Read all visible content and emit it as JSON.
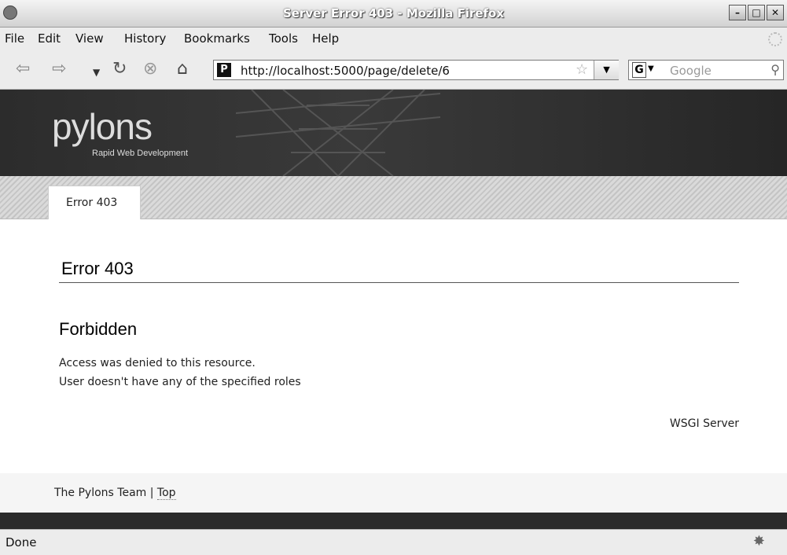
{
  "window": {
    "title": "Server Error 403 - Mozilla Firefox"
  },
  "menu": [
    "File",
    "Edit",
    "View",
    "History",
    "Bookmarks",
    "Tools",
    "Help"
  ],
  "nav": {
    "url": "http://localhost:5000/page/delete/6",
    "search_placeholder": "Google",
    "search_engine": "G"
  },
  "site": {
    "logo": "pylons",
    "tagline": "Rapid Web Development",
    "tab_label": "Error 403"
  },
  "content": {
    "heading": "Error 403",
    "subheading": "Forbidden",
    "message_lines": [
      "Access was denied to this resource.",
      "User doesn't have any of the specified roles"
    ],
    "server": "WSGI Server"
  },
  "footer": {
    "team": "The Pylons Team",
    "separator": " | ",
    "top_link": "Top"
  },
  "status": {
    "text": "Done"
  },
  "icons": [
    "back-icon",
    "forward-icon",
    "history-dropdown-icon",
    "reload-icon",
    "stop-icon",
    "home-icon",
    "site-icon",
    "bookmark-star-icon",
    "url-dropdown-icon",
    "search-engine-icon",
    "magnifier-icon",
    "throbber-icon",
    "bug-icon"
  ]
}
